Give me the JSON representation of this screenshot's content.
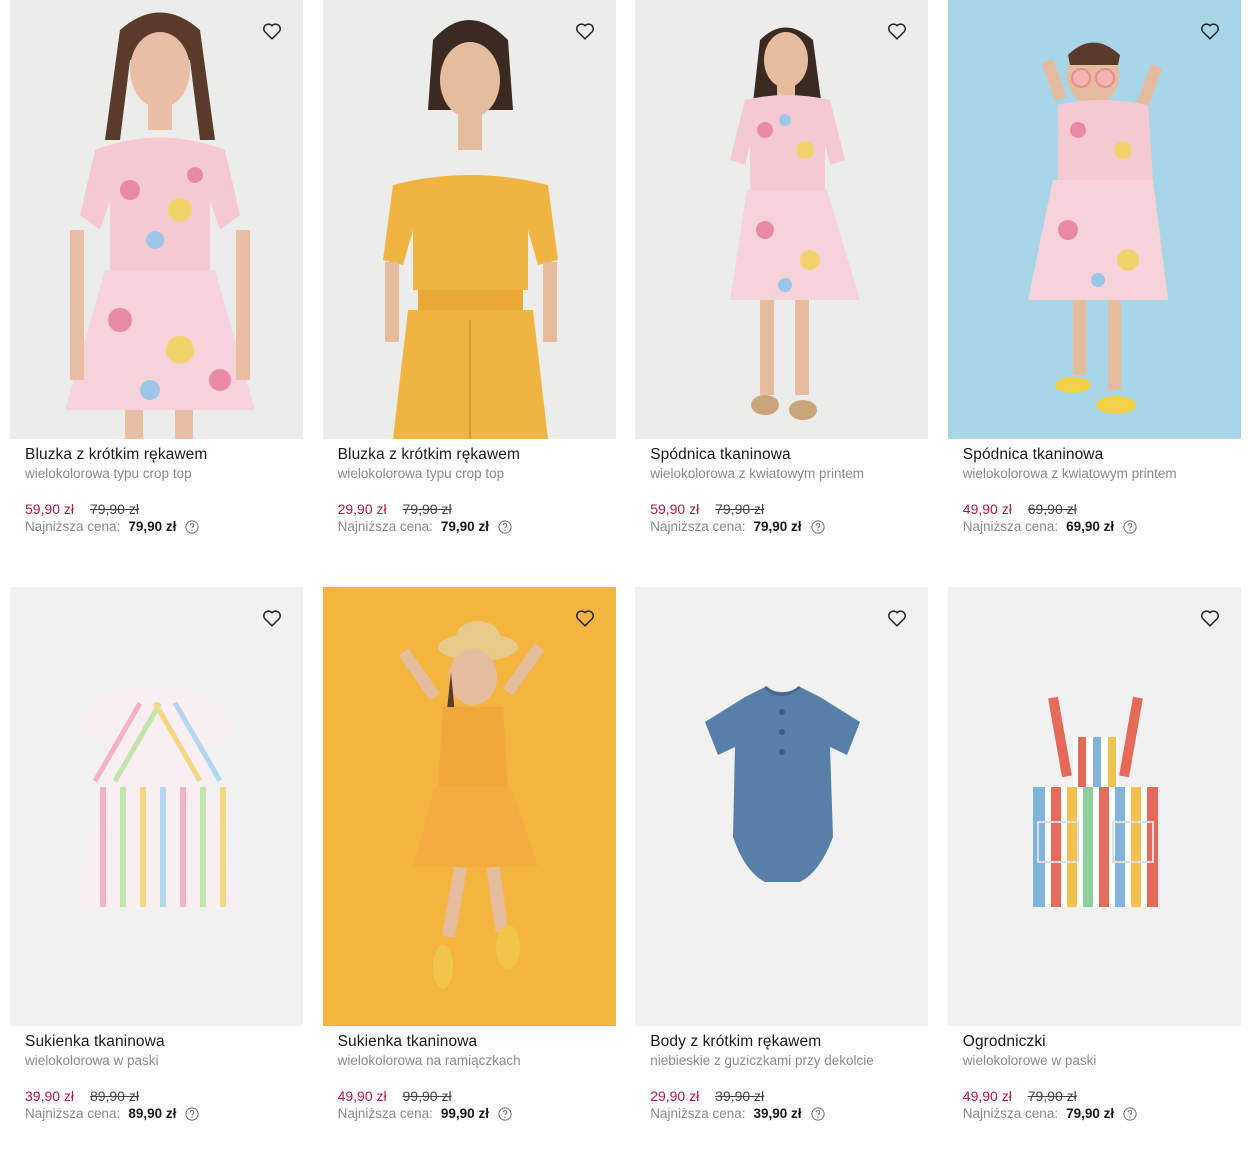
{
  "colors": {
    "sale_price": "#b0184a",
    "muted_text": "#8a8a8a",
    "card_bg": "#f1f1f1"
  },
  "icons": {
    "favorite": "heart-outline-icon",
    "help": "question-circle-icon"
  },
  "products": [
    {
      "title": "Bluzka z krótkim rękawem",
      "subtitle": "wielokolorowa typu crop top",
      "price": "59,90 zł",
      "old_price": "79,90 zł",
      "lowest_label": "Najniższa cena:",
      "lowest_value": "79,90 zł"
    },
    {
      "title": "Bluzka z krótkim rękawem",
      "subtitle": "wielokolorowa typu crop top",
      "price": "29,90 zł",
      "old_price": "79,90 zł",
      "lowest_label": "Najniższa cena:",
      "lowest_value": "79,90 zł"
    },
    {
      "title": "Spódnica tkaninowa",
      "subtitle": "wielokolorowa z kwiatowym printem",
      "price": "59,90 zł",
      "old_price": "79,90 zł",
      "lowest_label": "Najniższa cena:",
      "lowest_value": "79,90 zł"
    },
    {
      "title": "Spódnica tkaninowa",
      "subtitle": "wielokolorowa z kwiatowym printem",
      "price": "49,90 zł",
      "old_price": "69,90 zł",
      "lowest_label": "Najniższa cena:",
      "lowest_value": "69,90 zł"
    },
    {
      "title": "Sukienka tkaninowa",
      "subtitle": "wielokolorowa w paski",
      "price": "39,90 zł",
      "old_price": "89,90 zł",
      "lowest_label": "Najniższa cena:",
      "lowest_value": "89,90 zł"
    },
    {
      "title": "Sukienka tkaninowa",
      "subtitle": "wielokolorowa na ramiączkach",
      "price": "49,90 zł",
      "old_price": "99,90 zł",
      "lowest_label": "Najniższa cena:",
      "lowest_value": "99,90 zł"
    },
    {
      "title": "Body z krótkim rękawem",
      "subtitle": "niebieskie z guziczkami przy dekolcie",
      "price": "29,90 zł",
      "old_price": "39,90 zł",
      "lowest_label": "Najniższa cena:",
      "lowest_value": "39,90 zł"
    },
    {
      "title": "Ogrodniczki",
      "subtitle": "wielokolorowe w paski",
      "price": "49,90 zł",
      "old_price": "79,90 zł",
      "lowest_label": "Najniższa cena:",
      "lowest_value": "79,90 zł"
    }
  ]
}
